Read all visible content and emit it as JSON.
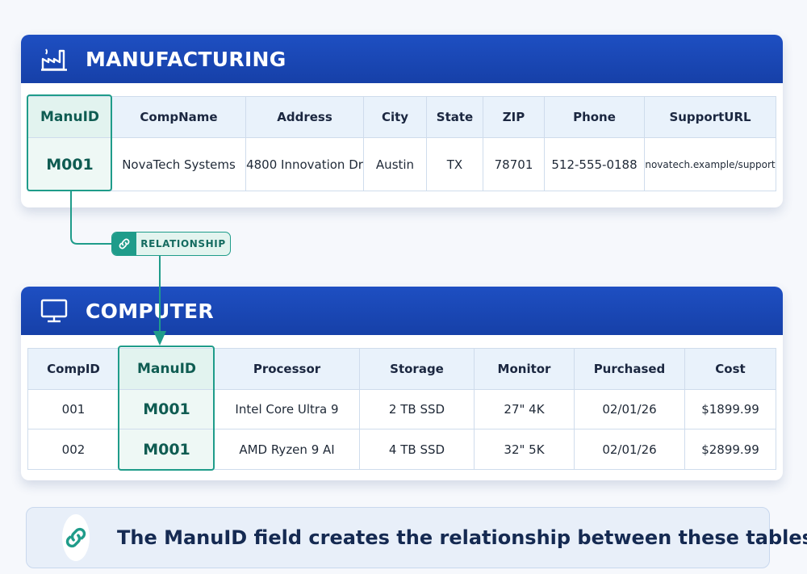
{
  "manufacturing": {
    "title": "MANUFACTURING",
    "columns": [
      "ManuID",
      "CompName",
      "Address",
      "City",
      "State",
      "ZIP",
      "Phone",
      "SupportURL"
    ],
    "rows": [
      [
        "M001",
        "NovaTech Systems",
        "4800 Innovation Dr",
        "Austin",
        "TX",
        "78701",
        "512-555-0188",
        "novatech.example/support"
      ]
    ]
  },
  "computer": {
    "title": "COMPUTER",
    "columns": [
      "CompID",
      "ManuID",
      "Processor",
      "Storage",
      "Monitor",
      "Purchased",
      "Cost"
    ],
    "rows": [
      [
        "001",
        "M001",
        "Intel Core Ultra 9",
        "2 TB SSD",
        "27\" 4K",
        "02/01/26",
        "$1899.99"
      ],
      [
        "002",
        "M001",
        "AMD Ryzen 9 AI",
        "4 TB SSD",
        "32\" 5K",
        "02/01/26",
        "$2899.99"
      ]
    ]
  },
  "relationship": {
    "label": "RELATIONSHIP"
  },
  "note": {
    "text": "The ManuID field creates the relationship between these tables."
  },
  "icons": {
    "manufacturing": "factory-icon",
    "computer": "monitor-icon",
    "relationship": "link-icon",
    "note": "link-icon"
  },
  "colors": {
    "header_blue": "#1a47b8",
    "key_teal": "#1f9c8a",
    "header_cell": "#e9f2fb",
    "note_bg": "#e8eff9",
    "note_text": "#152a52"
  }
}
